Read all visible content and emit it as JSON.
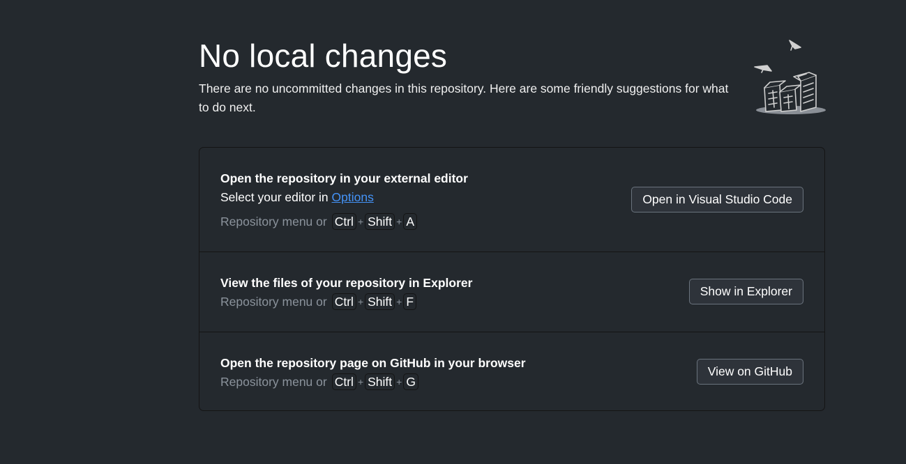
{
  "header": {
    "title": "No local changes",
    "subtitle": "There are no uncommitted changes in this repository. Here are some friendly suggestions for what to do next."
  },
  "suggestions": [
    {
      "title": "Open the repository in your external editor",
      "description_prefix": "Select your editor in ",
      "description_link": "Options",
      "shortcut_prefix": "Repository menu or",
      "keys": [
        "Ctrl",
        "Shift",
        "A"
      ],
      "button_label": "Open in Visual Studio Code"
    },
    {
      "title": "View the files of your repository in Explorer",
      "shortcut_prefix": "Repository menu or",
      "keys": [
        "Ctrl",
        "Shift",
        "F"
      ],
      "button_label": "Show in Explorer"
    },
    {
      "title": "Open the repository page on GitHub in your browser",
      "shortcut_prefix": "Repository menu or",
      "keys": [
        "Ctrl",
        "Shift",
        "G"
      ],
      "button_label": "View on GitHub"
    }
  ],
  "plus_symbol": "+",
  "colors": {
    "background": "#24292e",
    "link": "#4493f8",
    "muted_text": "#8b939c",
    "button_bg": "#2e333a",
    "button_border": "#6a737d"
  },
  "icons": {
    "illustration": "empty-boxes-illustration-icon"
  }
}
